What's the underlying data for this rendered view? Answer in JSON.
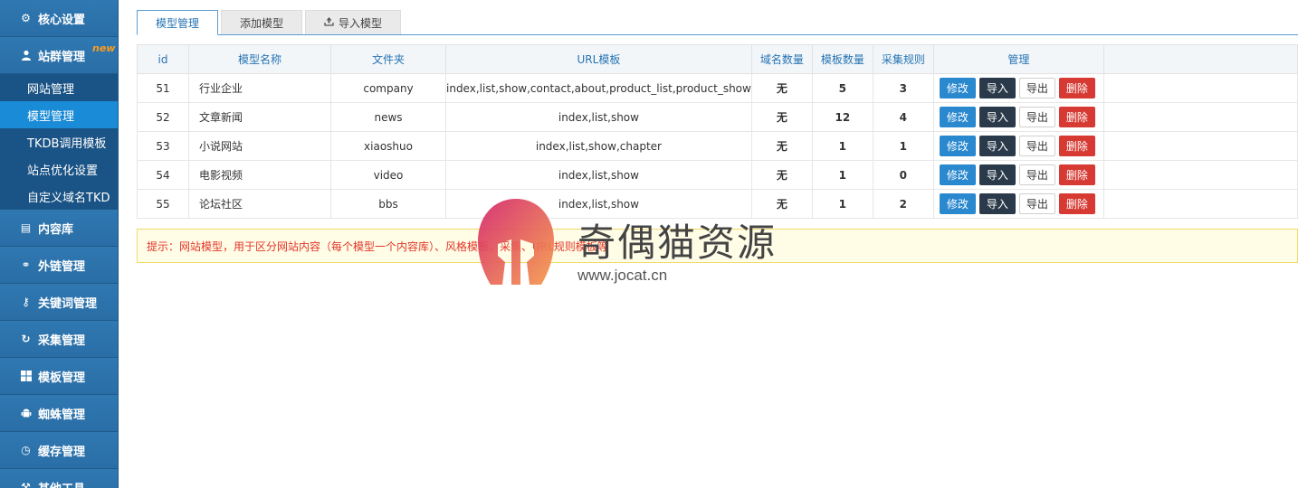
{
  "sidebar": {
    "core": {
      "label": "核心设置",
      "icon": "gear-icon"
    },
    "sites": {
      "label": "站群管理",
      "badge": "new",
      "icon": "user-icon",
      "items": [
        {
          "label": "网站管理",
          "active": false
        },
        {
          "label": "模型管理",
          "active": true
        },
        {
          "label": "TKDB调用模板",
          "active": false
        },
        {
          "label": "站点优化设置",
          "active": false
        },
        {
          "label": "自定义域名TKD",
          "active": false
        }
      ]
    },
    "groups": [
      {
        "label": "内容库",
        "icon": "list-icon"
      },
      {
        "label": "外链管理",
        "icon": "link-icon"
      },
      {
        "label": "关键词管理",
        "icon": "key-icon"
      },
      {
        "label": "采集管理",
        "icon": "refresh-icon"
      },
      {
        "label": "模板管理",
        "icon": "windows-icon"
      },
      {
        "label": "蜘蛛管理",
        "icon": "android-icon"
      },
      {
        "label": "缓存管理",
        "icon": "dashboard-icon"
      },
      {
        "label": "其他工具",
        "icon": "tool-icon"
      }
    ]
  },
  "tabs": [
    {
      "label": "模型管理",
      "active": true
    },
    {
      "label": "添加模型",
      "active": false
    },
    {
      "label": "导入模型",
      "active": false,
      "icon": "upload-icon"
    }
  ],
  "table": {
    "headers": [
      "id",
      "模型名称",
      "文件夹",
      "URL模板",
      "域名数量",
      "模板数量",
      "采集规则",
      "管理"
    ],
    "rows": [
      {
        "id": "51",
        "name": "行业企业",
        "folder": "company",
        "url": "index,list,show,contact,about,product_list,product_show",
        "domains": "无",
        "templates": "5",
        "rules": "3"
      },
      {
        "id": "52",
        "name": "文章新闻",
        "folder": "news",
        "url": "index,list,show",
        "domains": "无",
        "templates": "12",
        "rules": "4"
      },
      {
        "id": "53",
        "name": "小说网站",
        "folder": "xiaoshuo",
        "url": "index,list,show,chapter",
        "domains": "无",
        "templates": "1",
        "rules": "1"
      },
      {
        "id": "54",
        "name": "电影视频",
        "folder": "video",
        "url": "index,list,show",
        "domains": "无",
        "templates": "1",
        "rules": "0"
      },
      {
        "id": "55",
        "name": "论坛社区",
        "folder": "bbs",
        "url": "index,list,show",
        "domains": "无",
        "templates": "1",
        "rules": "2"
      }
    ],
    "actions": {
      "edit": "修改",
      "import": "导入",
      "export": "导出",
      "delete": "删除"
    }
  },
  "notice": "提示：网站模型，用于区分网站内容（每个模型一个内容库）、风格模板、采集、URL规则模板等",
  "watermark": {
    "title": "奇偶猫资源",
    "url": "www.jocat.cn"
  },
  "colors": {
    "sidebar": "#2a6fa6",
    "active_sub": "#1a8bd6",
    "accent": "#2674b4",
    "danger": "#d63a33"
  }
}
